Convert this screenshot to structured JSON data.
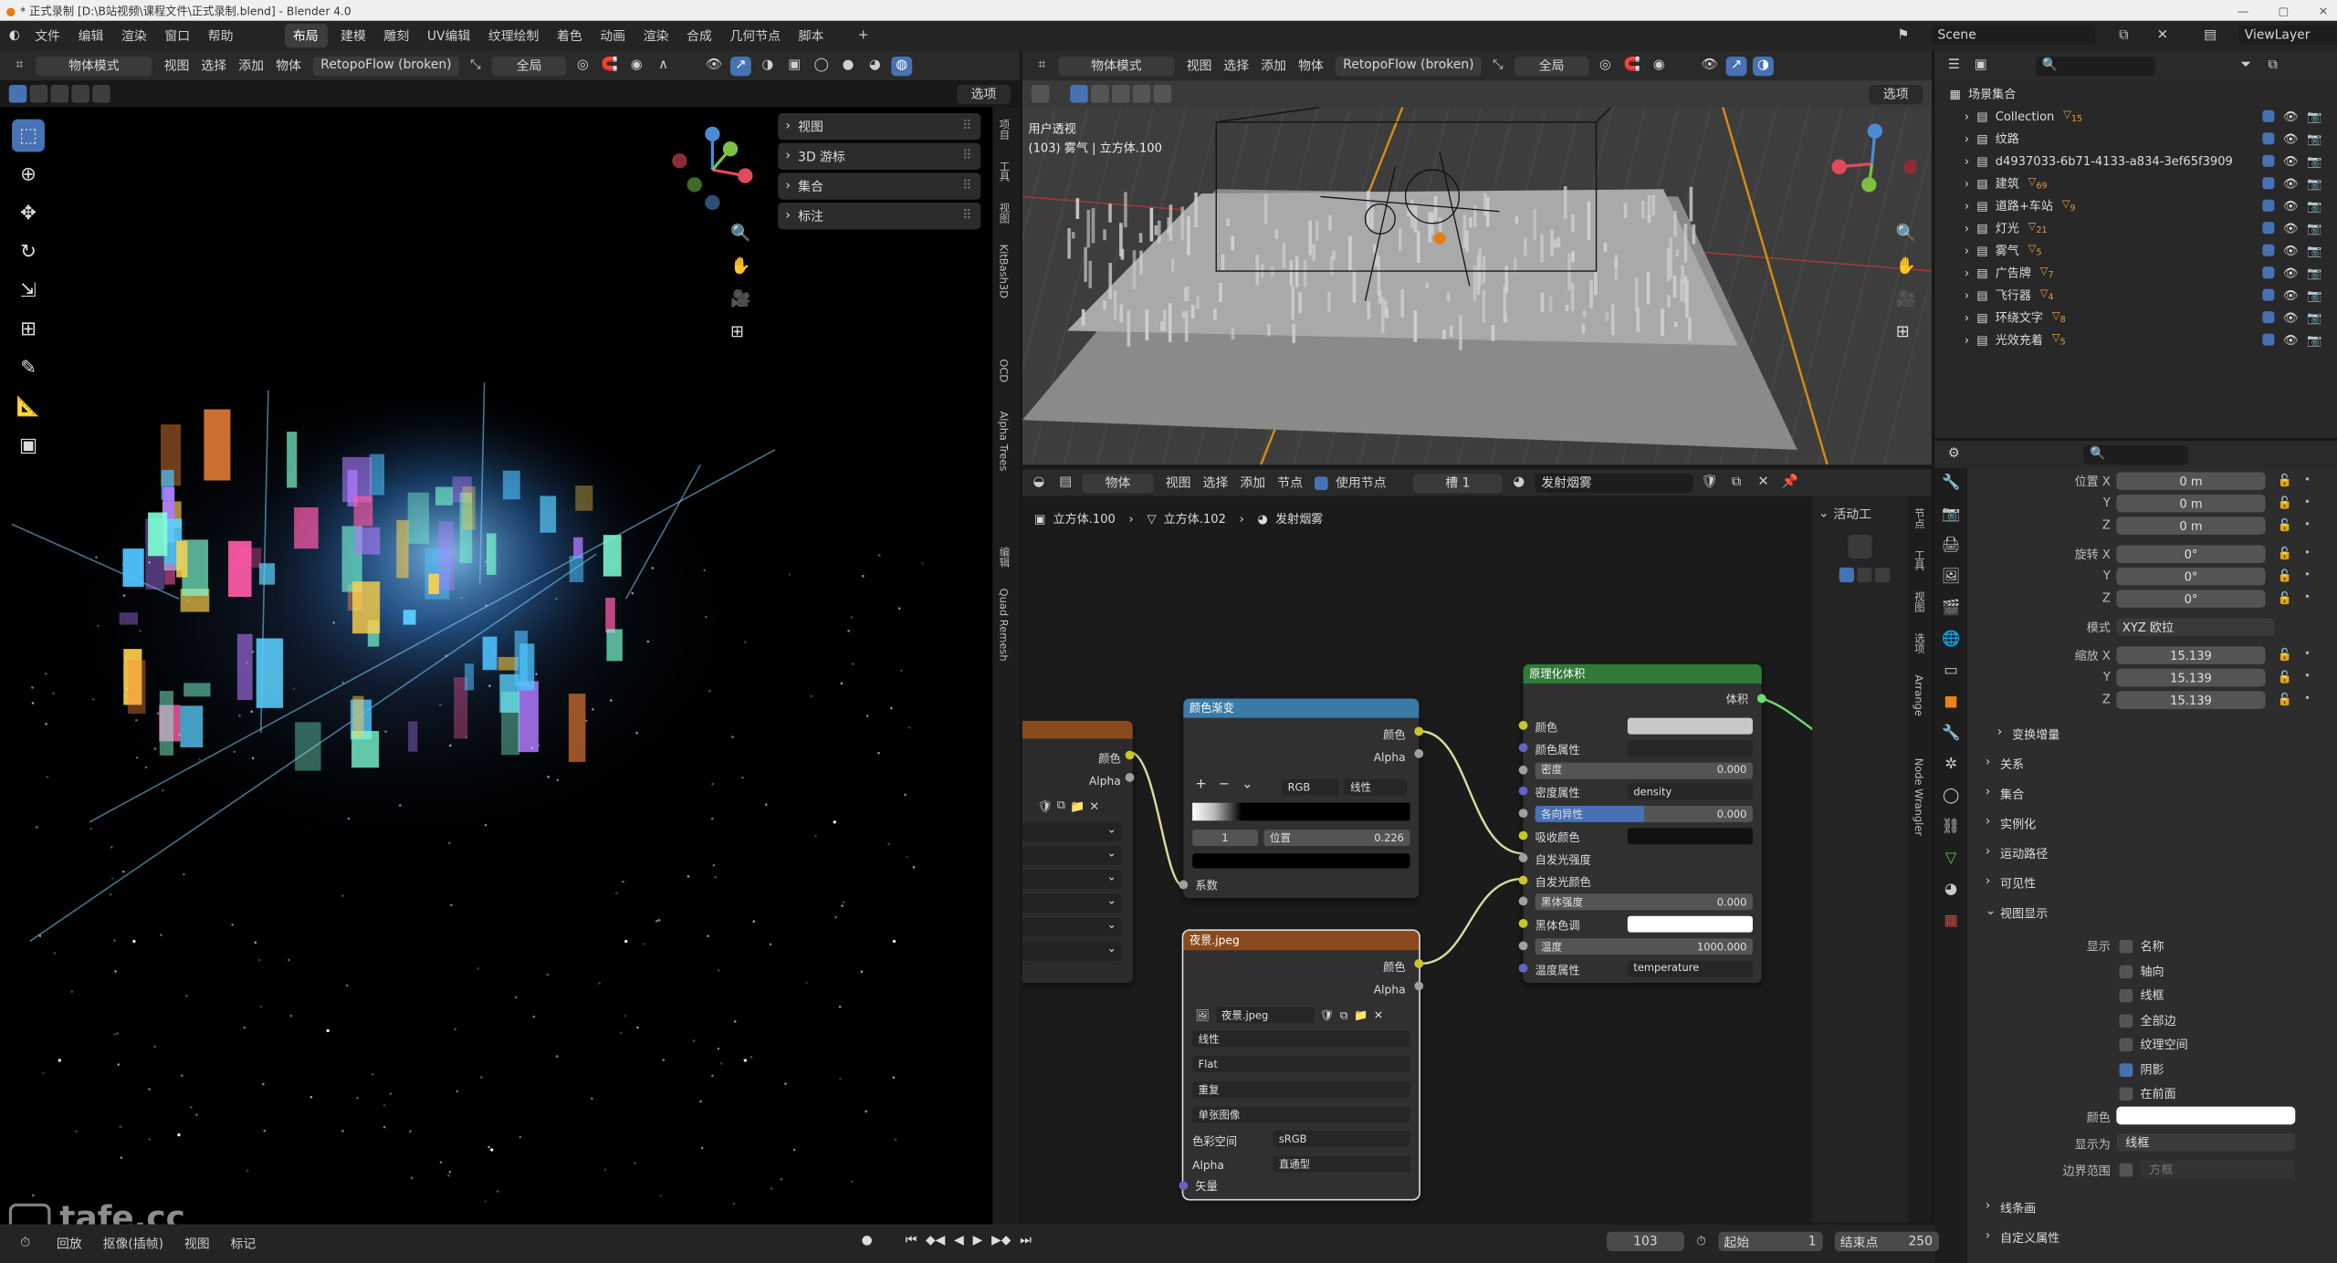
{
  "title_bar": {
    "title": "* 正式录制 [D:\\B站视频\\课程文件\\正式录制.blend] - Blender 4.0"
  },
  "top_menu": {
    "items": [
      "文件",
      "编辑",
      "渲染",
      "窗口",
      "帮助"
    ],
    "workspaces": [
      "布局",
      "建模",
      "雕刻",
      "UV编辑",
      "纹理绘制",
      "着色",
      "动画",
      "渲染",
      "合成",
      "几何节点",
      "脚本"
    ],
    "active_workspace": "布局",
    "add_tab": "+",
    "scene": "Scene",
    "view_layer": "ViewLayer"
  },
  "viewport_left": {
    "mode": "物体模式",
    "menus": [
      "视图",
      "选择",
      "添加",
      "物体"
    ],
    "retopo": "RetopoFlow (broken)",
    "orientation": "全局",
    "options_label": "选项",
    "n_panel": [
      "视图",
      "3D 游标",
      "集合",
      "标注"
    ],
    "side_tabs": [
      "项目",
      "工具",
      "视图",
      "KitBash3D",
      "OCD",
      "Alpha Trees",
      "编辑",
      "Quad Remesh"
    ]
  },
  "viewport_right": {
    "mode": "物体模式",
    "menus": [
      "视图",
      "选择",
      "添加",
      "物体"
    ],
    "retopo": "RetopoFlow (broken)",
    "orientation": "全局",
    "options_label": "选项",
    "overlay_line1": "用户透视",
    "overlay_line2": "(103) 雾气 | 立方体.100"
  },
  "node_editor": {
    "type": "物体",
    "menus": [
      "视图",
      "选择",
      "添加",
      "节点"
    ],
    "use_nodes_label": "使用节点",
    "slot": "槽 1",
    "material": "发射烟雾",
    "breadcrumb": [
      "立方体.100",
      "立方体.102",
      "发射烟雾"
    ],
    "active_tool_label": "活动工",
    "side_tabs": [
      "节点",
      "工具",
      "视图",
      "选项",
      "Arrange",
      "Node Wrangler"
    ],
    "partial_node": {
      "outputs": [
        "颜色",
        "Alpha"
      ]
    },
    "color_ramp": {
      "title": "颜色渐变",
      "outputs": [
        "颜色",
        "Alpha"
      ],
      "mode": "RGB",
      "interp": "线性",
      "stop_index": "1",
      "pos_label": "位置",
      "pos_value": "0.226",
      "input": "系数"
    },
    "image_node": {
      "title": "夜景.jpeg",
      "outputs": [
        "颜色",
        "Alpha"
      ],
      "image_name": "夜景.jpeg",
      "interp": "线性",
      "projection": "Flat",
      "extension": "重复",
      "source": "单张图像",
      "colorspace_label": "色彩空间",
      "colorspace": "sRGB",
      "alpha_label": "Alpha",
      "alpha": "直通型",
      "input": "矢量"
    },
    "volume_node": {
      "title": "原理化体积",
      "output": "体积",
      "rows": [
        {
          "label": "颜色",
          "value": ""
        },
        {
          "label": "颜色属性",
          "value": ""
        },
        {
          "label": "密度",
          "value": "0.000"
        },
        {
          "label": "密度属性",
          "value": "density"
        },
        {
          "label": "各向异性",
          "value": "0.000"
        },
        {
          "label": "吸收颜色",
          "value": ""
        },
        {
          "label": "自发光强度",
          "value": ""
        },
        {
          "label": "自发光颜色",
          "value": ""
        },
        {
          "label": "黑体强度",
          "value": "0.000"
        },
        {
          "label": "黑体色调",
          "value": ""
        },
        {
          "label": "温度",
          "value": "1000.000"
        },
        {
          "label": "温度属性",
          "value": "temperature"
        }
      ]
    }
  },
  "outliner": {
    "root": "场景集合",
    "items": [
      {
        "name": "Collection",
        "badge": "15"
      },
      {
        "name": "纹路",
        "badge": ""
      },
      {
        "name": "d4937033-6b71-4133-a834-3ef65f3909",
        "badge": ""
      },
      {
        "name": "建筑",
        "badge": "69"
      },
      {
        "name": "道路+车站",
        "badge": "9"
      },
      {
        "name": "灯光",
        "badge": "21"
      },
      {
        "name": "雾气",
        "badge": "5"
      },
      {
        "name": "广告牌",
        "badge": "7"
      },
      {
        "name": "飞行器",
        "badge": "4"
      },
      {
        "name": "环绕文字",
        "badge": "8"
      },
      {
        "name": "光效充着",
        "badge": "5"
      }
    ]
  },
  "properties": {
    "location_label": "位置 X",
    "location": [
      "0 m",
      "0 m",
      "0 m"
    ],
    "rotation_label": "旋转 X",
    "rotation": [
      "0°",
      "0°",
      "0°"
    ],
    "mode_label": "模式",
    "mode": "XYZ 欧拉",
    "scale_label": "缩放 X",
    "scale": [
      "15.139",
      "15.139",
      "15.139"
    ],
    "axis_y": "Y",
    "axis_z": "Z",
    "delta": "变换增量",
    "sections": [
      "关系",
      "集合",
      "实例化",
      "运动路径",
      "可见性"
    ],
    "viewport_display": "视图显示",
    "show_label": "显示",
    "show_items": [
      {
        "label": "名称",
        "checked": false
      },
      {
        "label": "轴向",
        "checked": false
      },
      {
        "label": "线框",
        "checked": false
      },
      {
        "label": "全部边",
        "checked": false
      },
      {
        "label": "纹理空间",
        "checked": false
      },
      {
        "label": "阴影",
        "checked": true
      },
      {
        "label": "在前面",
        "checked": false
      }
    ],
    "color_label": "颜色",
    "display_as_label": "显示为",
    "display_as": "线框",
    "bounds_label": "边界范围",
    "bounds_value": "方框",
    "bottom_sections": [
      "线条画",
      "自定义属性"
    ]
  },
  "timeline": {
    "menus": [
      "回放",
      "抠像(插帧)",
      "视图",
      "标记"
    ],
    "current_frame": "103",
    "start_label": "起始",
    "start": "1",
    "end_label": "结束点",
    "end": "250"
  },
  "watermark": "tafe.cc"
}
